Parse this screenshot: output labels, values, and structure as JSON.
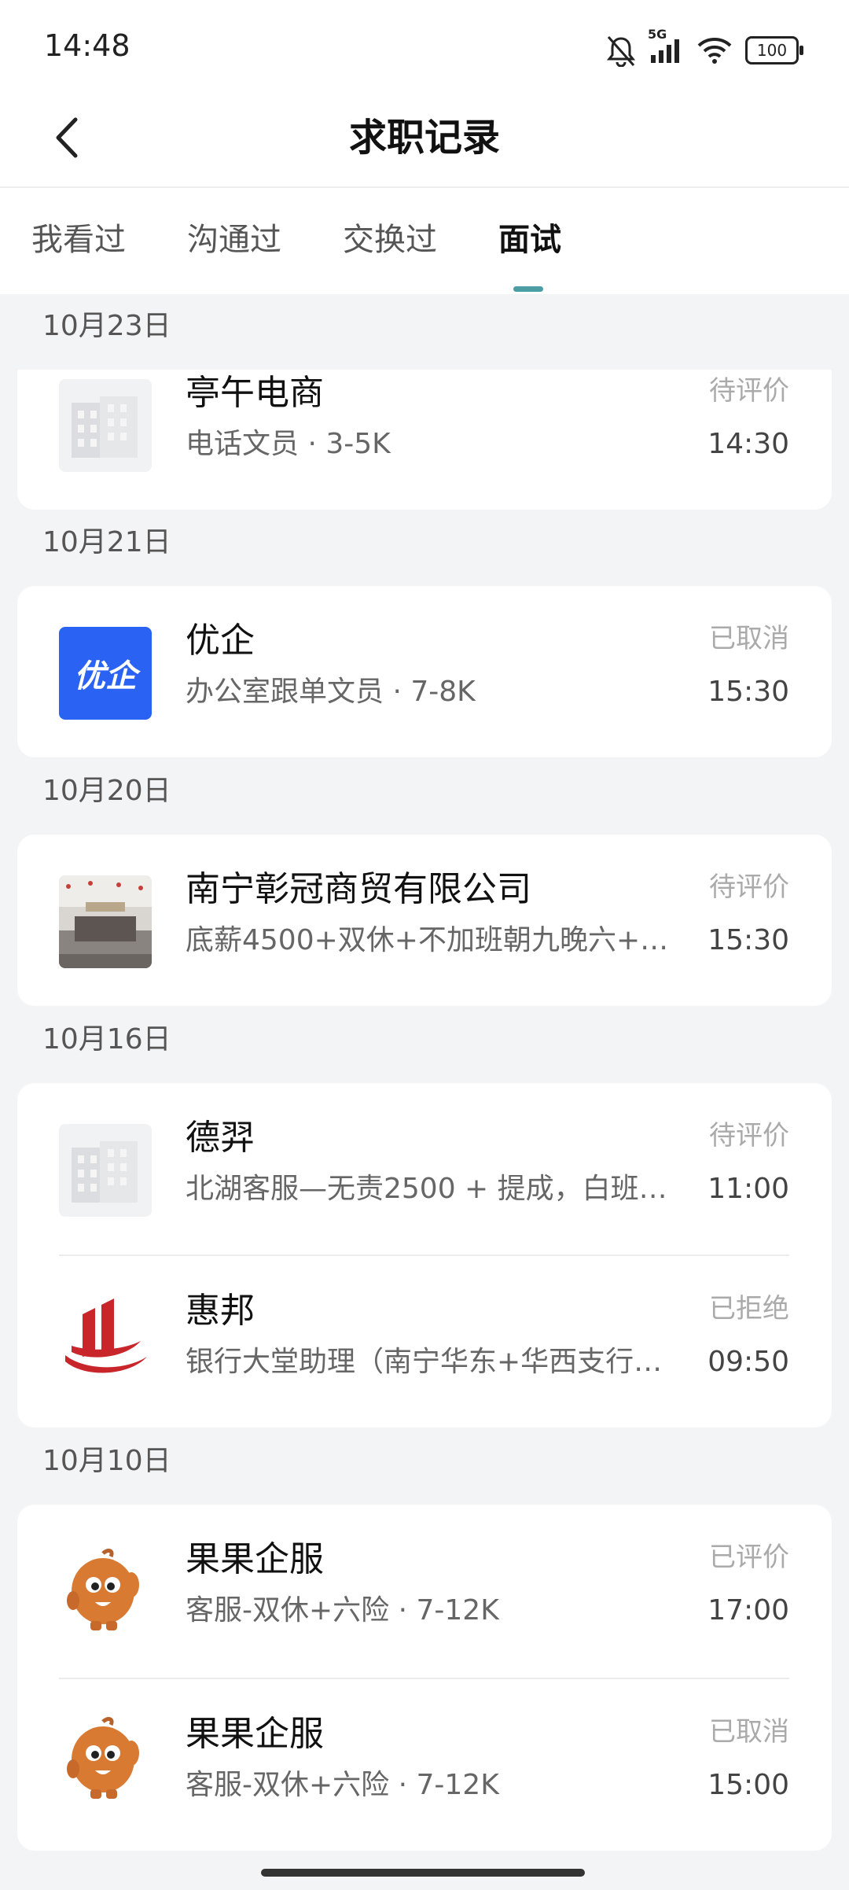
{
  "status_bar": {
    "time": "14:48",
    "network": "5G",
    "battery": "100"
  },
  "header": {
    "title": "求职记录"
  },
  "tabs": [
    {
      "label": "我看过",
      "active": false
    },
    {
      "label": "沟通过",
      "active": false
    },
    {
      "label": "交换过",
      "active": false
    },
    {
      "label": "面试",
      "active": true
    }
  ],
  "groups": [
    {
      "date": "10月23日",
      "items": [
        {
          "company": "亭午电商",
          "subtitle": "电话文员 · 3-5K",
          "status": "待评价",
          "time": "14:30",
          "logo": "building-placeholder-icon"
        }
      ]
    },
    {
      "date": "10月21日",
      "items": [
        {
          "company": "优企",
          "subtitle": "办公室跟单文员 · 7-8K",
          "status": "已取消",
          "time": "15:30",
          "logo": "youqi-logo",
          "logo_text": "优企"
        }
      ]
    },
    {
      "date": "10月20日",
      "items": [
        {
          "company": "南宁彰冠商贸有限公司",
          "subtitle": "底薪4500+双休+不加班朝九晚六+…",
          "status": "待评价",
          "time": "15:30",
          "logo": "office-photo"
        }
      ]
    },
    {
      "date": "10月16日",
      "items": [
        {
          "company": "德羿",
          "subtitle": "北湖客服—无责2500 + 提成，白班…",
          "status": "待评价",
          "time": "11:00",
          "logo": "building-placeholder-icon"
        },
        {
          "company": "惠邦",
          "subtitle": "银行大堂助理（南宁华东+华西支行…",
          "status": "已拒绝",
          "time": "09:50",
          "logo": "huibang-logo"
        }
      ]
    },
    {
      "date": "10月10日",
      "items": [
        {
          "company": "果果企服",
          "subtitle": "客服-双休+六险 · 7-12K",
          "status": "已评价",
          "time": "17:00",
          "logo": "mascot-logo"
        },
        {
          "company": "果果企服",
          "subtitle": "客服-双休+六险 · 7-12K",
          "status": "已取消",
          "time": "15:00",
          "logo": "mascot-logo"
        }
      ]
    }
  ],
  "colors": {
    "accent": "#4b9ea3",
    "youqi_blue": "#2a62f3",
    "huibang_red": "#c8262b",
    "mascot_orange": "#d97a33"
  }
}
